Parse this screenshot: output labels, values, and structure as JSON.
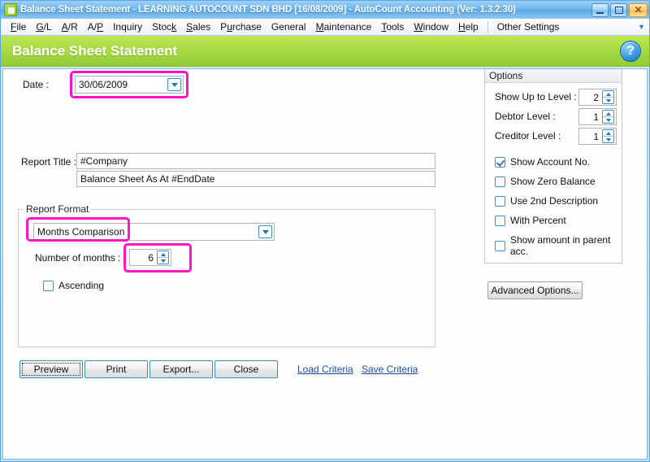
{
  "window": {
    "title": "Balance Sheet Statement - LEARNING AUTOCOUNT SDN BHD [16/08/2009] - AutoCount Accounting (Ver: 1.3.2.30)",
    "app_icon": "document-icon",
    "minimize_label": "",
    "maximize_label": "",
    "close_label": "✕"
  },
  "menubar": {
    "items": [
      {
        "label": "File"
      },
      {
        "label": "G/L"
      },
      {
        "label": "A/R"
      },
      {
        "label": "A/P"
      },
      {
        "label": "Inquiry"
      },
      {
        "label": "Stock"
      },
      {
        "label": "Sales"
      },
      {
        "label": "Purchase"
      },
      {
        "label": "General"
      },
      {
        "label": "Maintenance"
      },
      {
        "label": "Tools"
      },
      {
        "label": "Window"
      },
      {
        "label": "Help"
      }
    ],
    "trailing": {
      "label": "Other Settings"
    },
    "overflow_icon": "chevron-down-icon"
  },
  "banner": {
    "title": "Balance Sheet Statement",
    "help_icon": "help-circle-icon",
    "help_glyph": "?"
  },
  "form": {
    "date": {
      "label": "Date :",
      "value": "30/06/2009",
      "dropdown_icon": "chevron-down-icon"
    },
    "report_title": {
      "label": "Report Title :",
      "line1": "#Company",
      "line2": "Balance Sheet As At #EndDate"
    },
    "report_format": {
      "group_label": "Report Format",
      "format_value": "Months Comparison",
      "format_dropdown_icon": "chevron-down-icon",
      "months_label": "Number of months :",
      "months_value": "6",
      "spin_up_icon": "chevron-up-icon",
      "spin_down_icon": "chevron-down-icon",
      "ascending_label": "Ascending",
      "ascending_checked": false
    },
    "buttons": {
      "preview": "Preview",
      "print": "Print",
      "export": "Export...",
      "close": "Close"
    },
    "links": {
      "load_criteria": "Load Criteria",
      "save_criteria": "Save Criteria"
    }
  },
  "options": {
    "panel_title": "Options",
    "levels": [
      {
        "label": "Show Up to Level :",
        "value": "2"
      },
      {
        "label": "Debtor Level :",
        "value": "1"
      },
      {
        "label": "Creditor Level :",
        "value": "1"
      }
    ],
    "checkboxes": [
      {
        "label": "Show Account No.",
        "checked": true
      },
      {
        "label": "Show Zero Balance",
        "checked": false
      },
      {
        "label": "Use 2nd Description",
        "checked": false
      },
      {
        "label": "With Percent",
        "checked": false
      },
      {
        "label": "Show amount in parent acc.",
        "checked": false
      }
    ],
    "advanced_button": "Advanced Options...",
    "spin_up_icon": "chevron-up-icon",
    "spin_down_icon": "chevron-down-icon"
  },
  "annotations": {
    "highlight_color": "#ff14c8",
    "regions": [
      "date-field",
      "report-format-dropdown",
      "number-of-months-spinner"
    ]
  },
  "colors": {
    "banner_green": "#aadc45",
    "titlebar_blue": "#6fb7ee",
    "link_blue": "#1d4fa0",
    "accent_magenta": "#ff14c8"
  }
}
